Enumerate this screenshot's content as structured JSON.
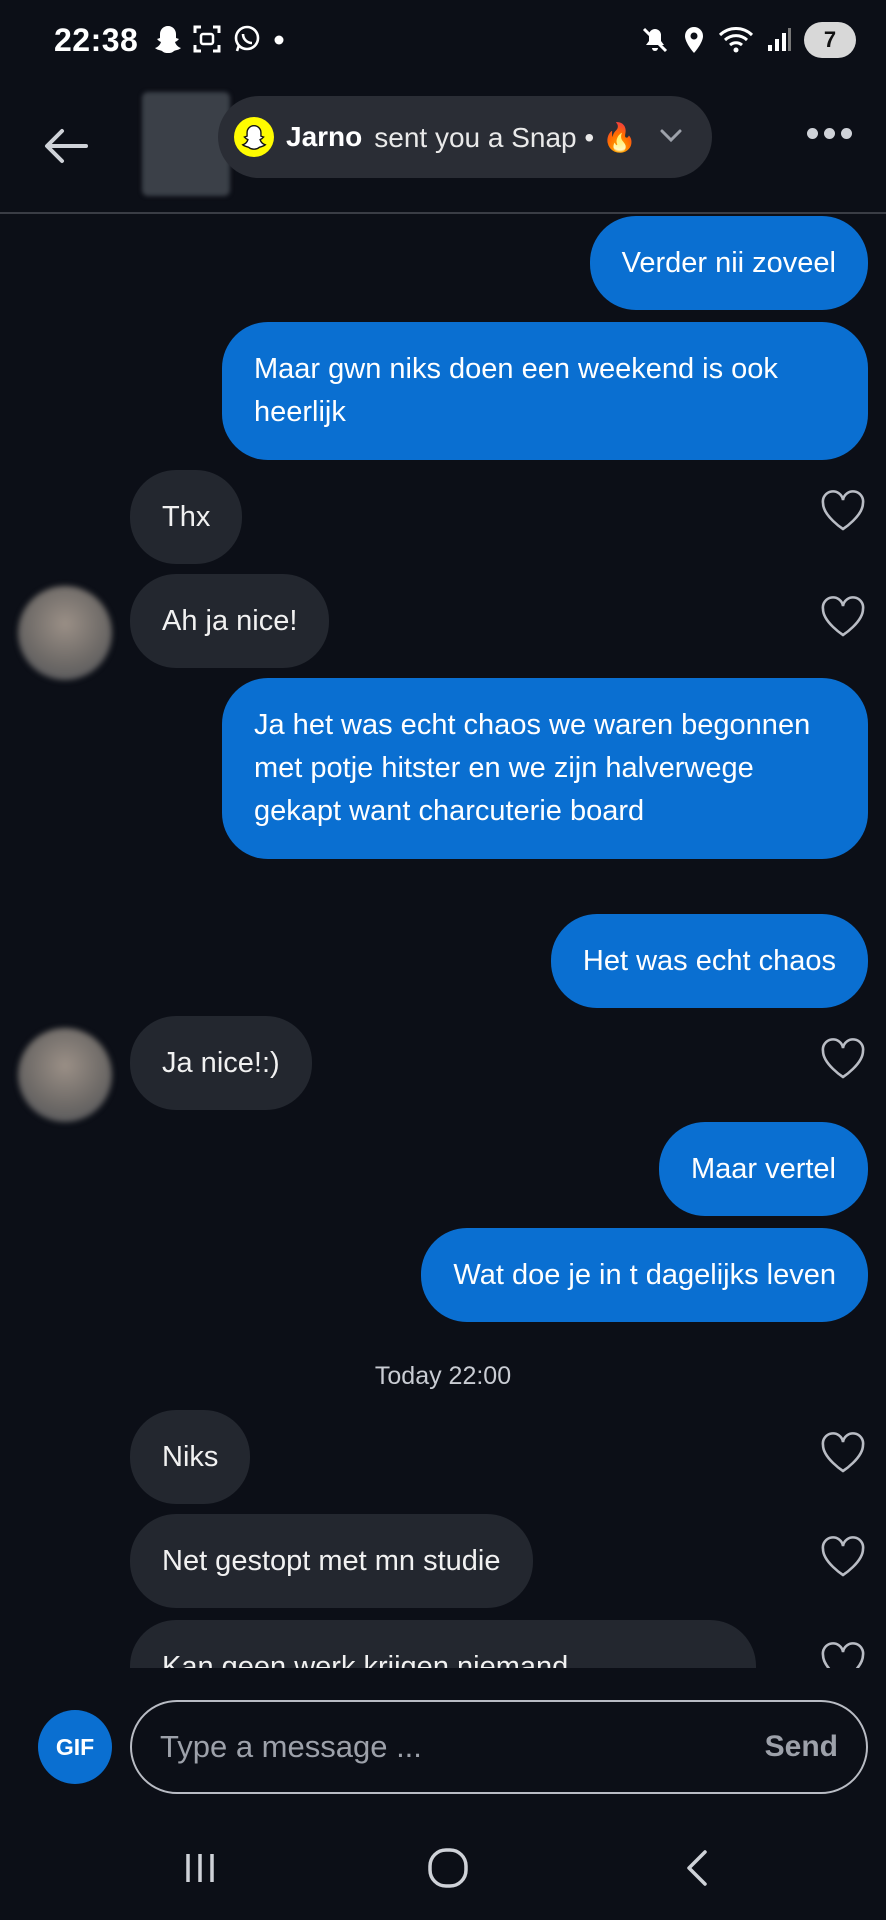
{
  "status_bar": {
    "time": "22:38",
    "battery": "7",
    "left_icons": [
      "snapchat-ghost-icon",
      "screenshot-icon",
      "whatsapp-icon",
      "dot-icon"
    ],
    "right_icons": [
      "mute-icon",
      "location-icon",
      "wifi-icon",
      "signal-icon",
      "battery-icon"
    ]
  },
  "header": {
    "notif_name": "Jarno",
    "notif_text": "sent you a Snap • 🔥"
  },
  "messages": [
    {
      "dir": "out",
      "text": "Verder nii zoveel"
    },
    {
      "dir": "out",
      "text": "Maar gwn niks doen een weekend is ook heerlijk"
    },
    {
      "dir": "in",
      "text": "Thx"
    },
    {
      "dir": "in",
      "text": "Ah ja nice!"
    },
    {
      "dir": "out",
      "text": "Ja het was echt chaos we waren begonnen met potje hitster en we zijn halverwege gekapt want charcuterie board"
    },
    {
      "dir": "out",
      "text": "Het was echt chaos"
    },
    {
      "dir": "in",
      "text": "Ja nice!:)"
    },
    {
      "dir": "out",
      "text": "Maar vertel"
    },
    {
      "dir": "out",
      "text": "Wat doe je in t dagelijks leven"
    },
    {
      "dir": "in",
      "text": "Niks"
    },
    {
      "dir": "in",
      "text": "Net gestopt met mn studie"
    },
    {
      "dir": "in",
      "text": "Kan geen werk krijgen niemand"
    }
  ],
  "date_separator": "Today 22:00",
  "composer": {
    "gif_label": "GIF",
    "placeholder": "Type a message ...",
    "send_label": "Send"
  },
  "colors": {
    "background": "#0c0f17",
    "outgoing_bubble": "#0a6fd1",
    "incoming_bubble": "#23272f",
    "snap_yellow": "#fffc00"
  }
}
